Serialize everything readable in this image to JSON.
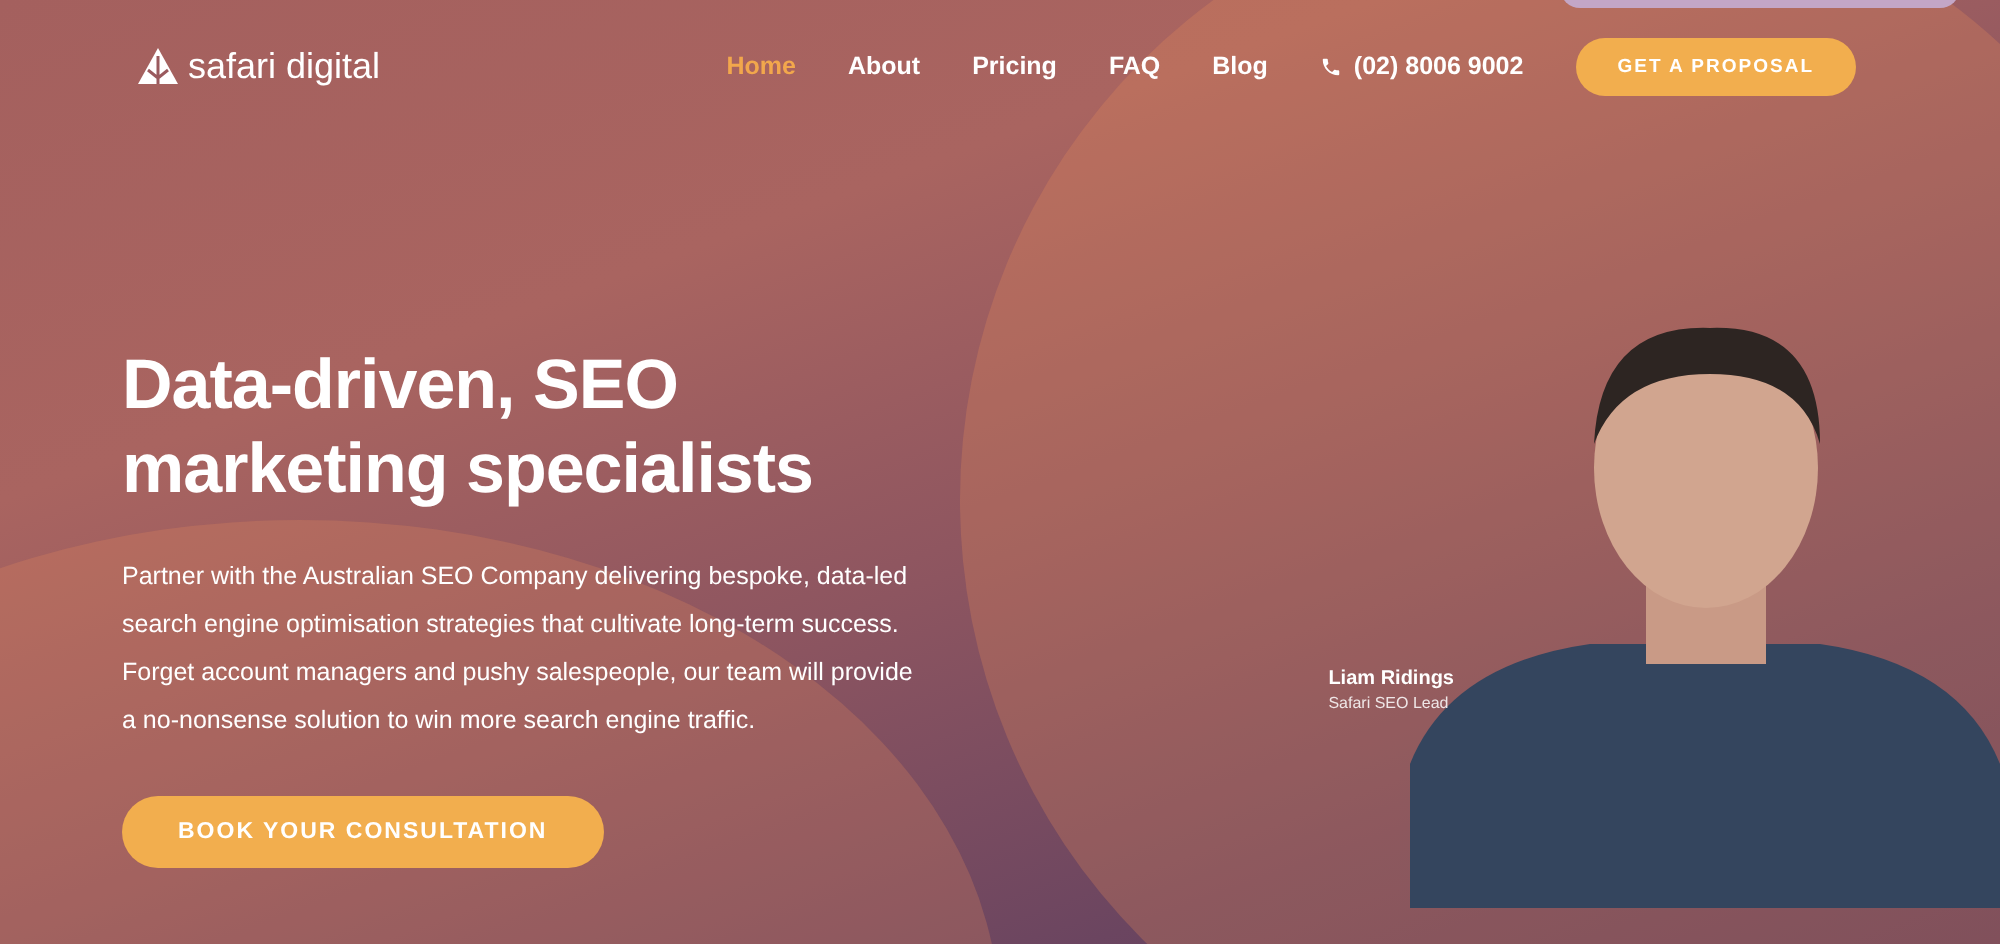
{
  "brand": {
    "name": "safari digital"
  },
  "nav": [
    {
      "label": "Home",
      "selected": true
    },
    {
      "label": "About",
      "selected": false
    },
    {
      "label": "Pricing",
      "selected": false
    },
    {
      "label": "FAQ",
      "selected": false
    },
    {
      "label": "Blog",
      "selected": false
    }
  ],
  "phone": "(02) 8006 9002",
  "cta": "GET A PROPOSAL",
  "hero": {
    "title": "Data-driven, SEO marketing specialists",
    "text": "Partner with the Australian SEO Company delivering bespoke, data-led search engine optimisation strategies that cultivate long-term success. Forget account managers and pushy salespeople, our team will provide a no-nonsense solution to win more search engine traffic.",
    "button": "BOOK YOUR CONSULTATION"
  },
  "person": {
    "name": "Liam Ridings",
    "role": "Safari SEO Lead"
  }
}
